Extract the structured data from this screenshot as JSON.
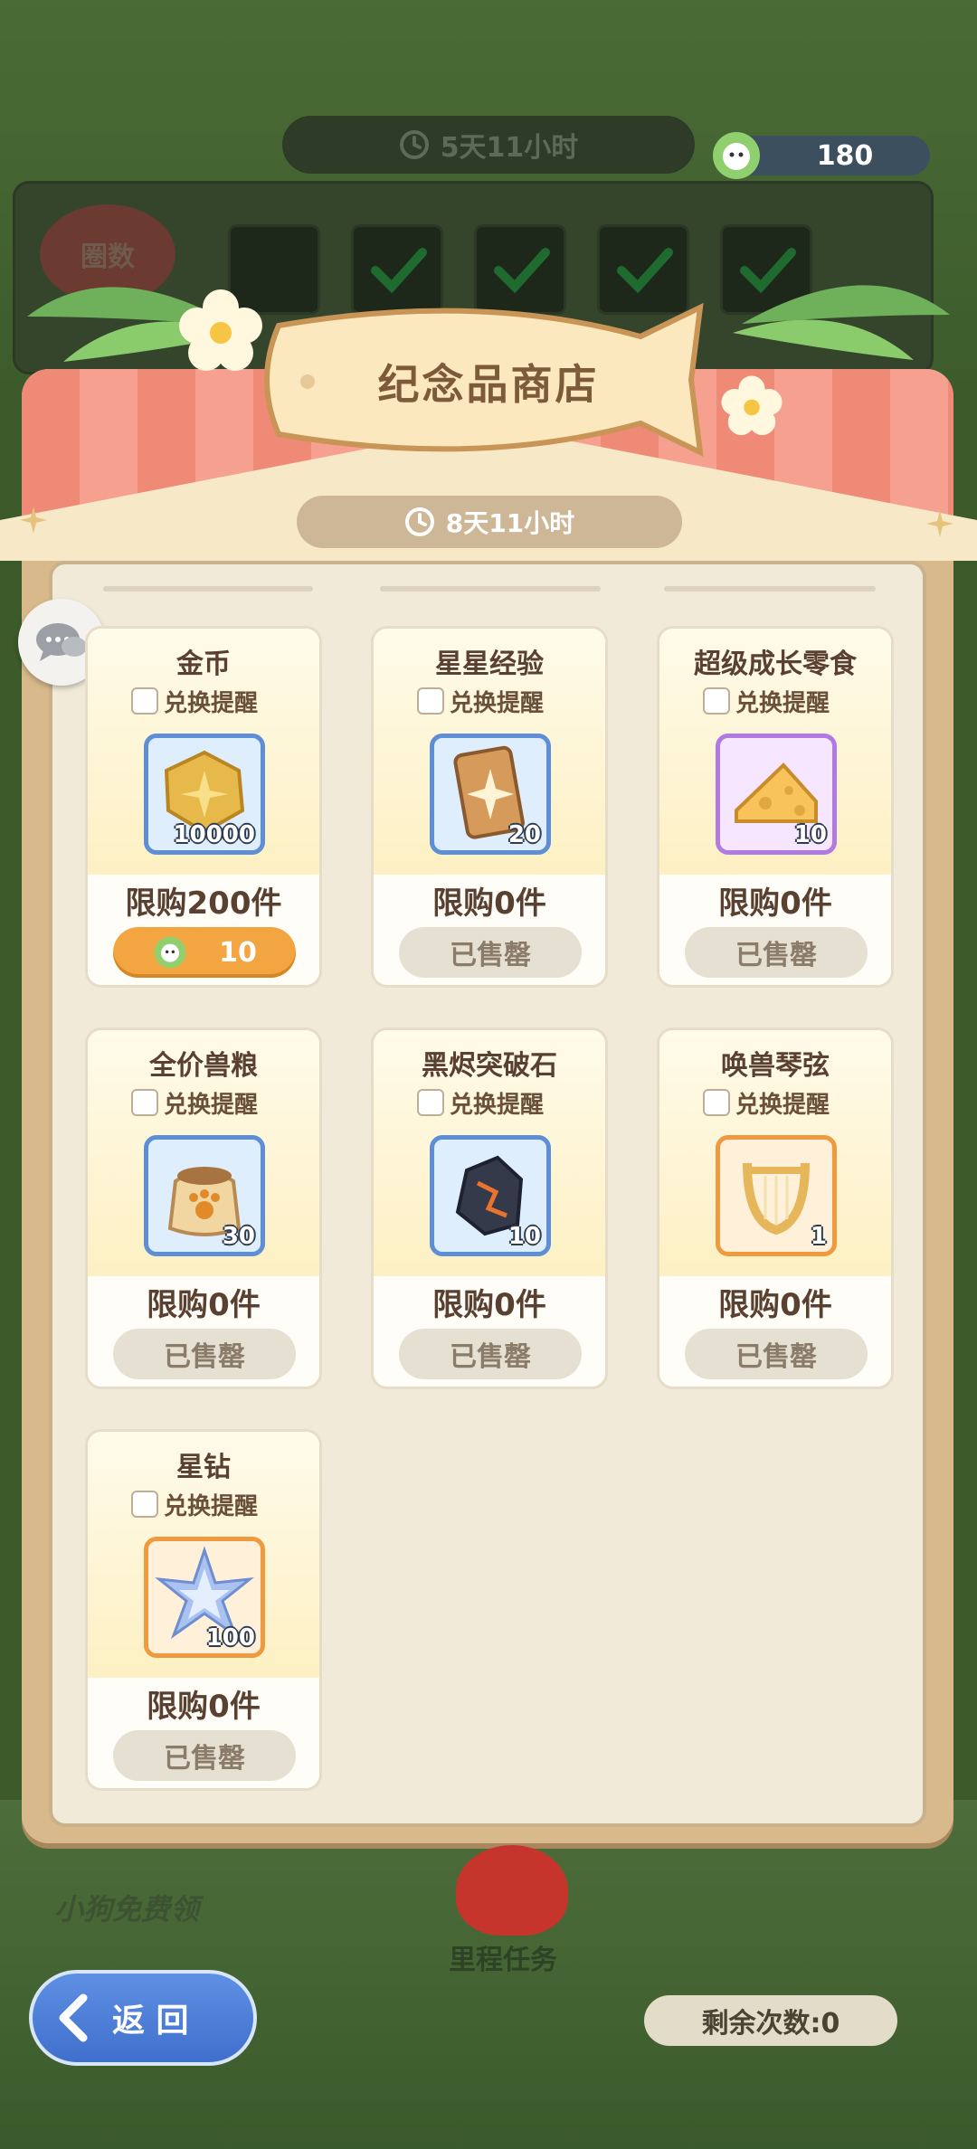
{
  "header": {
    "event_timer": "5天11小时",
    "currency_amount": "180",
    "rounds_label": "圈数"
  },
  "shop": {
    "title": "纪念品商店",
    "timer": "8天11小时",
    "remind_label": "兑换提醒",
    "items": [
      {
        "name": "金币",
        "qty": "10000",
        "limit": "限购200件",
        "button": "10",
        "frame": "blue",
        "icon": "gold-coin-icon",
        "sold_out": false
      },
      {
        "name": "星星经验",
        "qty": "20",
        "limit": "限购0件",
        "button": "已售罄",
        "frame": "blue",
        "icon": "star-card-icon",
        "sold_out": true
      },
      {
        "name": "超级成长零食",
        "qty": "10",
        "limit": "限购0件",
        "button": "已售罄",
        "frame": "purple",
        "icon": "cheese-icon",
        "sold_out": true
      },
      {
        "name": "全价兽粮",
        "qty": "30",
        "limit": "限购0件",
        "button": "已售罄",
        "frame": "blue",
        "icon": "pet-food-bag-icon",
        "sold_out": true
      },
      {
        "name": "黑烬突破石",
        "qty": "10",
        "limit": "限购0件",
        "button": "已售罄",
        "frame": "blue",
        "icon": "black-ember-stone-icon",
        "sold_out": true
      },
      {
        "name": "唤兽琴弦",
        "qty": "1",
        "limit": "限购0件",
        "button": "已售罄",
        "frame": "orange",
        "icon": "lyre-icon",
        "sold_out": true
      },
      {
        "name": "星钻",
        "qty": "100",
        "limit": "限购0件",
        "button": "已售罄",
        "frame": "orange",
        "icon": "star-diamond-icon",
        "sold_out": true
      }
    ]
  },
  "bottom": {
    "back_label": "返 回",
    "free_dog": "小狗免费领",
    "mileage": "里程任务",
    "remaining": "剩余次数:0"
  },
  "colors": {
    "accent_orange": "#f2a540",
    "frame_blue": "#5e8fd6",
    "frame_purple": "#b17ae3",
    "frame_orange": "#ef9a3e",
    "awning_red": "#ef8a76"
  }
}
